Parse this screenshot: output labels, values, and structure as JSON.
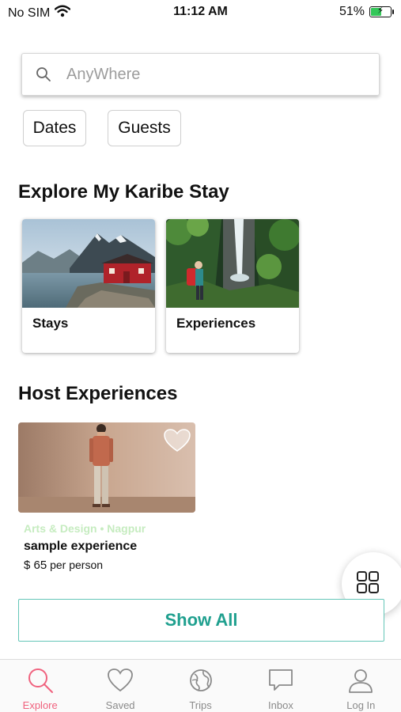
{
  "status_bar": {
    "carrier": "No SIM",
    "time": "11:12 AM",
    "battery_percent": "51%",
    "battery_level": 0.51
  },
  "search": {
    "placeholder": "AnyWhere",
    "icon": "search-icon"
  },
  "filters": {
    "dates_label": "Dates",
    "guests_label": "Guests"
  },
  "explore_section": {
    "title": "Explore My Karibe Stay",
    "cards": [
      {
        "label": "Stays"
      },
      {
        "label": "Experiences"
      }
    ]
  },
  "host_section": {
    "title": "Host Experiences",
    "experience": {
      "category": "Arts & Design • Nagpur",
      "title": "sample experience",
      "price": "$ 65",
      "price_unit": "per person"
    }
  },
  "show_all_label": "Show All",
  "tab_bar": {
    "tabs": [
      {
        "label": "Explore",
        "icon": "search-icon",
        "active": true
      },
      {
        "label": "Saved",
        "icon": "heart-icon",
        "active": false
      },
      {
        "label": "Trips",
        "icon": "globe-icon",
        "active": false
      },
      {
        "label": "Inbox",
        "icon": "chat-bubble-icon",
        "active": false
      },
      {
        "label": "Log In",
        "icon": "user-icon",
        "active": false
      }
    ]
  },
  "colors": {
    "accent": "#20a08f",
    "active_tab": "#f0627e",
    "category_text": "#c6ecc0"
  }
}
